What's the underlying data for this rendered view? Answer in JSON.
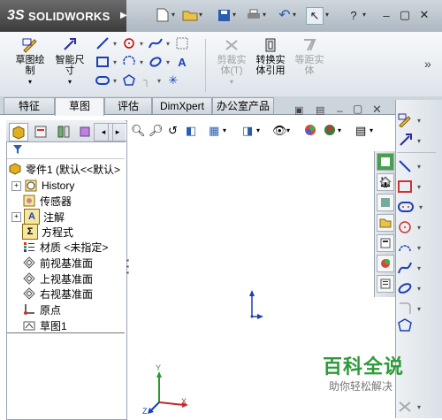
{
  "app": {
    "logo_mark": "3S",
    "logo_text": "SOLIDWORKS",
    "logo_arrow": "▶"
  },
  "quick_access": {
    "icons": [
      "new-document-icon",
      "open-folder-icon",
      "save-icon",
      "print-icon",
      "undo-icon",
      "select-arrow-icon",
      "help-icon"
    ],
    "window_controls": {
      "minimize": "–",
      "restore": "▢",
      "close": "✕"
    }
  },
  "ribbon": {
    "buttons": [
      {
        "label_line1": "草图绘",
        "label_line2": "制",
        "disabled": false
      },
      {
        "label_line1": "智能尺",
        "label_line2": "寸",
        "disabled": false
      },
      {
        "label_line1": "剪裁实",
        "label_line2": "体(T)",
        "disabled": true
      },
      {
        "label_line1": "转换实",
        "label_line2": "体引用",
        "disabled": false
      },
      {
        "label_line1": "等距实",
        "label_line2": "体",
        "disabled": true
      }
    ],
    "expand": "»"
  },
  "tabs": [
    {
      "label": "特征"
    },
    {
      "label": "草图",
      "active": true
    },
    {
      "label": "评估"
    },
    {
      "label": "DimXpert"
    },
    {
      "label": "办公室产品"
    }
  ],
  "panel_tabs": {
    "nav_left": "◂",
    "nav_right": "▸"
  },
  "tree": {
    "root": "零件1 (默认<<默认>",
    "items": [
      {
        "label": "History",
        "icon": "history-icon",
        "expandable": true
      },
      {
        "label": "传感器",
        "icon": "sensor-icon",
        "expandable": false
      },
      {
        "label": "注解",
        "icon": "annotation-icon",
        "expandable": true
      },
      {
        "label": "方程式",
        "icon": "equation-icon",
        "expandable": false
      },
      {
        "label": "材质 <未指定>",
        "icon": "material-icon",
        "expandable": false
      },
      {
        "label": "前视基准面",
        "icon": "plane-icon",
        "expandable": false
      },
      {
        "label": "上视基准面",
        "icon": "plane-icon",
        "expandable": false
      },
      {
        "label": "右视基准面",
        "icon": "plane-icon",
        "expandable": false
      },
      {
        "label": "原点",
        "icon": "origin-icon",
        "expandable": false
      },
      {
        "label": "草图1",
        "icon": "sketch-icon",
        "expandable": false
      }
    ]
  },
  "watermark": {
    "main": "百科全说",
    "sub": "助你轻松解决"
  },
  "triad": {
    "x": "X",
    "y": "Y",
    "z": "Z"
  },
  "colors": {
    "accent_blue": "#1a3fb8",
    "watermark_green": "#2e9a3a"
  }
}
